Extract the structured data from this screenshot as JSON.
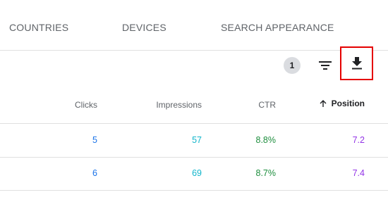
{
  "tabs": [
    {
      "label": "COUNTRIES"
    },
    {
      "label": "DEVICES"
    },
    {
      "label": "SEARCH APPEARANCE"
    }
  ],
  "toolbar": {
    "filter_count": "1",
    "filter_icon": "filter-icon",
    "download_icon": "download-icon",
    "highlight_color": "#e50000"
  },
  "table": {
    "columns": {
      "clicks": "Clicks",
      "impressions": "Impressions",
      "ctr": "CTR",
      "position": "Position"
    },
    "sort_icon": "arrow-up-icon",
    "rows": [
      {
        "clicks": "5",
        "impressions": "57",
        "ctr": "8.8%",
        "position": "7.2"
      },
      {
        "clicks": "6",
        "impressions": "69",
        "ctr": "8.7%",
        "position": "7.4"
      }
    ]
  },
  "colors": {
    "clicks": "#1a73e8",
    "impressions": "#12b5cb",
    "ctr": "#1e8e3e",
    "position": "#9334e6"
  }
}
